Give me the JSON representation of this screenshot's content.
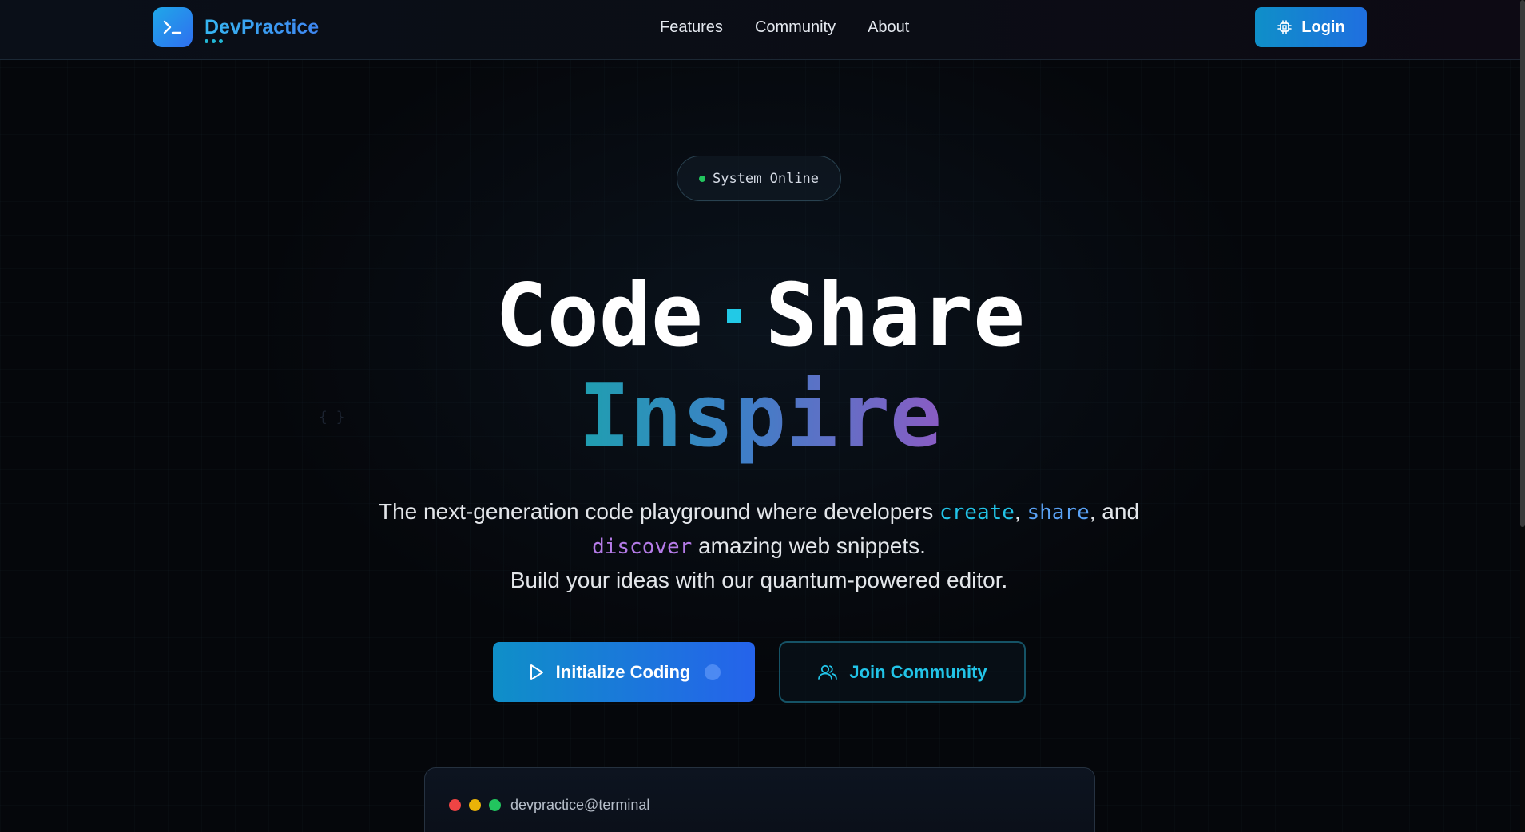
{
  "header": {
    "brand": "DevPractice",
    "nav": [
      {
        "label": "Features"
      },
      {
        "label": "Community"
      },
      {
        "label": "About"
      }
    ],
    "login_label": "Login"
  },
  "status": {
    "text": "System Online",
    "color": "#22c55e"
  },
  "hero": {
    "word1": "Code",
    "word2": "Share",
    "word3": "Inspire",
    "desc_part1": "The next-generation code playground where developers ",
    "kw_create": "create",
    "comma": ",",
    "kw_share": "share",
    "desc_part2": ", and",
    "kw_discover": "discover",
    "desc_part3": " amazing web snippets.",
    "desc_line3": "Build your ideas with our quantum-powered editor.",
    "faint_symbol": "{ }"
  },
  "cta": {
    "primary_label": "Initialize Coding",
    "secondary_label": "Join Community"
  },
  "terminal": {
    "title": "devpractice@terminal",
    "dots": [
      "#ef4444",
      "#eab308",
      "#22c55e"
    ]
  },
  "colors": {
    "accent": "#22c4e8",
    "brand_gradient": [
      "#1fa8e8",
      "#2f6ff0"
    ],
    "purple": "#b57be8"
  }
}
